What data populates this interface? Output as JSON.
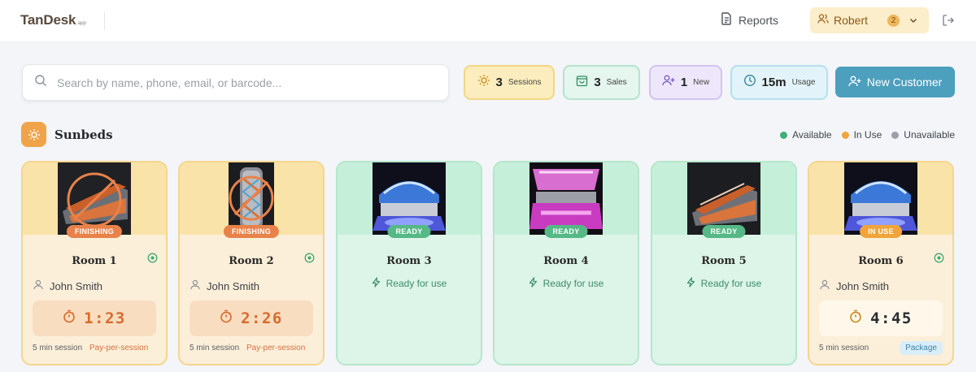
{
  "header": {
    "logo_main": "TanDesk",
    "logo_sub": ".app",
    "reports_label": "Reports",
    "user_name": "Robert",
    "user_badge": "2"
  },
  "search": {
    "placeholder": "Search by name, phone, email, or barcode..."
  },
  "stats": {
    "sessions": {
      "value": "3",
      "label": "Sessions"
    },
    "sales": {
      "value": "3",
      "label": "Sales"
    },
    "new": {
      "value": "1",
      "label": "New"
    },
    "usage": {
      "value": "15m",
      "label": "Usage"
    }
  },
  "new_customer_label": "New Customer",
  "section": {
    "title": "Sunbeds"
  },
  "legend": [
    {
      "label": "Available",
      "color": "#3fb07a"
    },
    {
      "label": "In Use",
      "color": "#f0a43b"
    },
    {
      "label": "Unavailable",
      "color": "#9aa0ab"
    }
  ],
  "rooms": [
    {
      "name": "Room 1",
      "status": "FINISHING",
      "customer": "John Smith",
      "timer": "1:23",
      "session": "5 min session",
      "payment": "Pay-per-session"
    },
    {
      "name": "Room 2",
      "status": "FINISHING",
      "customer": "John Smith",
      "timer": "2:26",
      "session": "5 min session",
      "payment": "Pay-per-session"
    },
    {
      "name": "Room 3",
      "status": "READY",
      "note": "Ready for use"
    },
    {
      "name": "Room 4",
      "status": "READY",
      "note": "Ready for use"
    },
    {
      "name": "Room 5",
      "status": "READY",
      "note": "Ready for use"
    },
    {
      "name": "Room 6",
      "status": "IN USE",
      "customer": "John Smith",
      "timer": "4:45",
      "session": "5 min session",
      "payment": "Package"
    }
  ]
}
